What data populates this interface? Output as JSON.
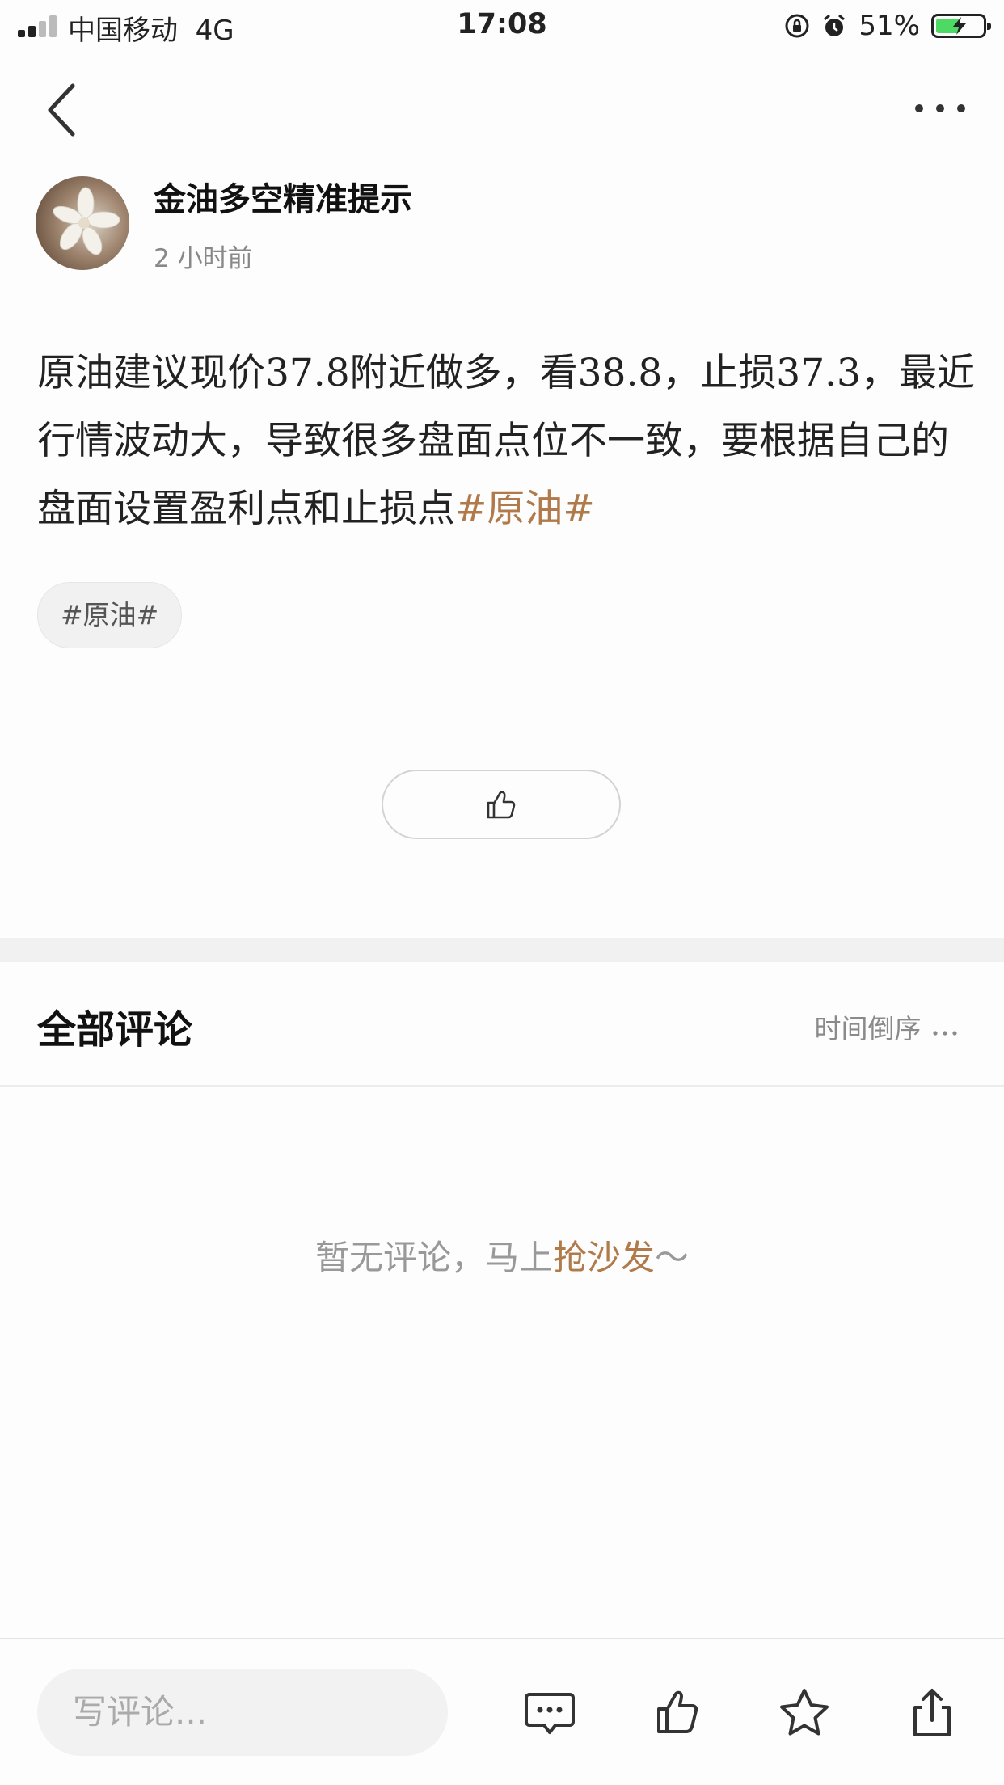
{
  "status_bar": {
    "carrier": "中国移动",
    "network": "4G",
    "time": "17:08",
    "battery_percent": "51%",
    "battery_level": 0.51,
    "icons": [
      "orientation-lock-icon",
      "alarm-icon",
      "battery-charging-icon"
    ]
  },
  "nav": {
    "back_icon": "chevron-left-icon",
    "more_icon": "ellipsis-icon"
  },
  "post": {
    "author": "金油多空精准提示",
    "time": "2 小时前",
    "content": "原油建议现价37.8附近做多，看38.8，止损37.3，最近行情波动大，导致很多盘面点位不一致，要根据自己的盘面设置盈利点和止损点",
    "inline_tag": "#原油#",
    "topic_chip": "#原油#",
    "like_icon": "thumbs-up-icon"
  },
  "comments": {
    "title": "全部评论",
    "sort_label": "时间倒序",
    "empty_prefix": "暂无评论，马上",
    "empty_link": "抢沙发",
    "empty_suffix": "～"
  },
  "bottom_bar": {
    "placeholder": "写评论...",
    "icons": [
      "comment-icon",
      "thumbs-up-icon",
      "star-icon",
      "share-icon"
    ]
  },
  "colors": {
    "accent": "#b07a4a",
    "battery": "#4cd964"
  }
}
